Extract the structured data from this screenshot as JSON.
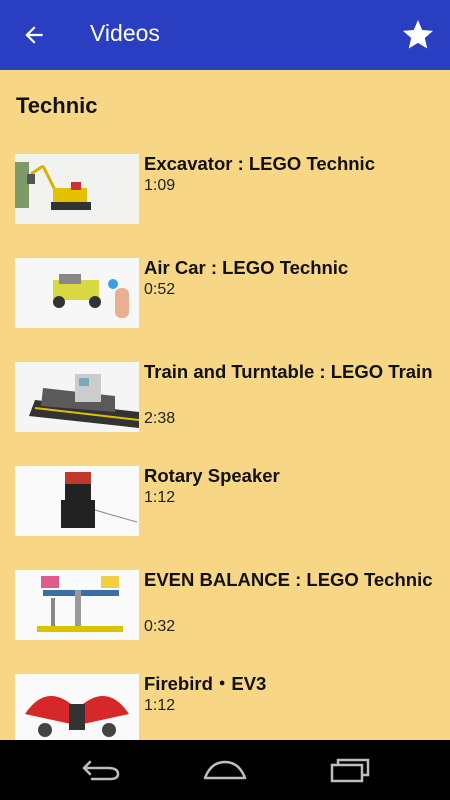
{
  "app_bar": {
    "title": "Videos",
    "back_icon": "arrow-back-icon",
    "favorite_icon": "star-icon"
  },
  "section": {
    "title": "Technic"
  },
  "videos": [
    {
      "title": "Excavator : LEGO Technic",
      "duration": "1:09",
      "thumbnail": "excavator-thumbnail"
    },
    {
      "title": "Air Car : LEGO Technic",
      "duration": "0:52",
      "thumbnail": "air-car-thumbnail"
    },
    {
      "title": "Train and Turntable : LEGO Train",
      "duration": "2:38",
      "thumbnail": "train-thumbnail"
    },
    {
      "title": "Rotary Speaker",
      "duration": "1:12",
      "thumbnail": "speaker-thumbnail"
    },
    {
      "title": "EVEN BALANCE : LEGO Technic",
      "duration": "0:32",
      "thumbnail": "balance-thumbnail"
    },
    {
      "title": "Firebird・EV3",
      "duration": "1:12",
      "thumbnail": "firebird-thumbnail"
    }
  ],
  "nav_bar": {
    "back_icon": "nav-back-icon",
    "home_icon": "nav-home-icon",
    "recents_icon": "nav-recents-icon"
  },
  "colors": {
    "app_bar": "#2a3ec2",
    "background": "#f7d785",
    "nav_bar": "#000000"
  }
}
